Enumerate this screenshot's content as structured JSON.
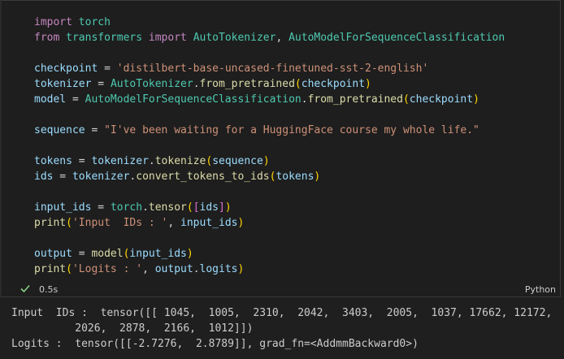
{
  "code_lines": [
    [
      {
        "t": "import",
        "c": "kw"
      },
      {
        "t": " ",
        "c": "pl"
      },
      {
        "t": "torch",
        "c": "cls"
      }
    ],
    [
      {
        "t": "from",
        "c": "kw"
      },
      {
        "t": " ",
        "c": "pl"
      },
      {
        "t": "transformers",
        "c": "cls"
      },
      {
        "t": " ",
        "c": "pl"
      },
      {
        "t": "import",
        "c": "kw"
      },
      {
        "t": " ",
        "c": "pl"
      },
      {
        "t": "AutoTokenizer",
        "c": "cls"
      },
      {
        "t": ", ",
        "c": "pl"
      },
      {
        "t": "AutoModelForSequenceClassification",
        "c": "cls"
      }
    ],
    [],
    [
      {
        "t": "checkpoint",
        "c": "var"
      },
      {
        "t": " = ",
        "c": "pl"
      },
      {
        "t": "'distilbert-base-uncased-finetuned-sst-2-english'",
        "c": "str"
      }
    ],
    [
      {
        "t": "tokenizer",
        "c": "var"
      },
      {
        "t": " = ",
        "c": "pl"
      },
      {
        "t": "AutoTokenizer",
        "c": "cls"
      },
      {
        "t": ".",
        "c": "pl"
      },
      {
        "t": "from_pretrained",
        "c": "fn"
      },
      {
        "t": "(",
        "c": "br1"
      },
      {
        "t": "checkpoint",
        "c": "var"
      },
      {
        "t": ")",
        "c": "br1"
      }
    ],
    [
      {
        "t": "model",
        "c": "var"
      },
      {
        "t": " = ",
        "c": "pl"
      },
      {
        "t": "AutoModelForSequenceClassification",
        "c": "cls"
      },
      {
        "t": ".",
        "c": "pl"
      },
      {
        "t": "from_pretrained",
        "c": "fn"
      },
      {
        "t": "(",
        "c": "br1"
      },
      {
        "t": "checkpoint",
        "c": "var"
      },
      {
        "t": ")",
        "c": "br1"
      }
    ],
    [],
    [
      {
        "t": "sequence",
        "c": "var"
      },
      {
        "t": " = ",
        "c": "pl"
      },
      {
        "t": "\"I've been waiting for a HuggingFace course my whole life.\"",
        "c": "str"
      }
    ],
    [],
    [
      {
        "t": "tokens",
        "c": "var"
      },
      {
        "t": " = ",
        "c": "pl"
      },
      {
        "t": "tokenizer",
        "c": "var"
      },
      {
        "t": ".",
        "c": "pl"
      },
      {
        "t": "tokenize",
        "c": "fn"
      },
      {
        "t": "(",
        "c": "br1"
      },
      {
        "t": "sequence",
        "c": "var"
      },
      {
        "t": ")",
        "c": "br1"
      }
    ],
    [
      {
        "t": "ids",
        "c": "var"
      },
      {
        "t": " = ",
        "c": "pl"
      },
      {
        "t": "tokenizer",
        "c": "var"
      },
      {
        "t": ".",
        "c": "pl"
      },
      {
        "t": "convert_tokens_to_ids",
        "c": "fn"
      },
      {
        "t": "(",
        "c": "br1"
      },
      {
        "t": "tokens",
        "c": "var"
      },
      {
        "t": ")",
        "c": "br1"
      }
    ],
    [],
    [
      {
        "t": "input_ids",
        "c": "var"
      },
      {
        "t": " = ",
        "c": "pl"
      },
      {
        "t": "torch",
        "c": "cls"
      },
      {
        "t": ".",
        "c": "pl"
      },
      {
        "t": "tensor",
        "c": "fn"
      },
      {
        "t": "(",
        "c": "br1"
      },
      {
        "t": "[",
        "c": "br2"
      },
      {
        "t": "ids",
        "c": "var"
      },
      {
        "t": "]",
        "c": "br2"
      },
      {
        "t": ")",
        "c": "br1"
      }
    ],
    [
      {
        "t": "print",
        "c": "fn"
      },
      {
        "t": "(",
        "c": "br1"
      },
      {
        "t": "'Input  IDs : '",
        "c": "str"
      },
      {
        "t": ", ",
        "c": "pl"
      },
      {
        "t": "input_ids",
        "c": "var"
      },
      {
        "t": ")",
        "c": "br1"
      }
    ],
    [],
    [
      {
        "t": "output",
        "c": "var"
      },
      {
        "t": " = ",
        "c": "pl"
      },
      {
        "t": "model",
        "c": "fn"
      },
      {
        "t": "(",
        "c": "br1"
      },
      {
        "t": "input_ids",
        "c": "var"
      },
      {
        "t": ")",
        "c": "br1"
      }
    ],
    [
      {
        "t": "print",
        "c": "fn"
      },
      {
        "t": "(",
        "c": "br1"
      },
      {
        "t": "'Logits : '",
        "c": "str"
      },
      {
        "t": ", ",
        "c": "pl"
      },
      {
        "t": "output",
        "c": "var"
      },
      {
        "t": ".",
        "c": "pl"
      },
      {
        "t": "logits",
        "c": "var"
      },
      {
        "t": ")",
        "c": "br1"
      }
    ]
  ],
  "status": {
    "elapsed": "0.5s",
    "language": "Python",
    "success_color": "#89d185",
    "status_icon": "check-icon"
  },
  "output_lines": [
    "Input  IDs :  tensor([[ 1045,  1005,  2310,  2042,  3403,  2005,  1037, 17662, 12172,  2",
    "          2026,  2878,  2166,  1012]])",
    "Logits :  tensor([[-2.7276,  2.8789]], grad_fn=<AddmmBackward0>)"
  ]
}
